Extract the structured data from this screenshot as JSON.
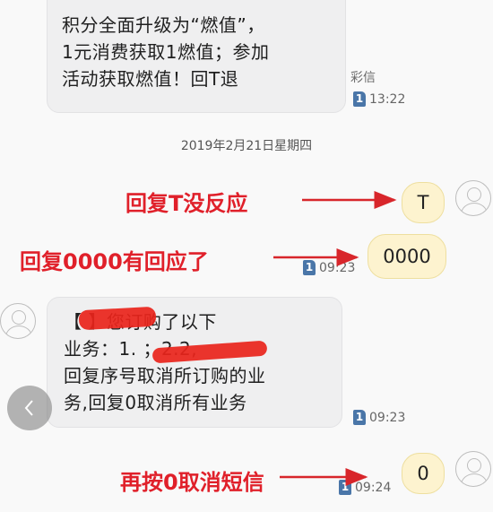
{
  "messages": {
    "incoming_1": {
      "lines": [
        "积分全面升级为“燃值”，",
        "1元消费获取1燃值；参加",
        "活动获取燃值！回T退"
      ],
      "type_label": "彩信",
      "sim": "1",
      "time": "13:22"
    },
    "date_separator": "2019年2月21日星期四",
    "sent_1": {
      "text": "T"
    },
    "sent_2": {
      "text": "0000",
      "sim": "1",
      "time": "09:23"
    },
    "incoming_2": {
      "lines": [
        "【      】您订购了以下",
        "业务：1.              ；2.2,",
        "回复序号取消所订购的业",
        "务,回复0取消所有业务"
      ],
      "sim": "1",
      "time": "09:23"
    },
    "sent_3": {
      "text": "0",
      "sim": "1",
      "time": "09:24"
    }
  },
  "annotations": {
    "a1": "回复T没反应",
    "a2": "回复0000有回应了",
    "a3": "再按0取消短信"
  },
  "colors": {
    "annotation_red": "#e0202a",
    "incoming_bubble": "#efeff0",
    "outgoing_bubble": "#fdf3cf",
    "sim_badge": "#4a76a8"
  },
  "icons": {
    "avatar": "person-outline-icon",
    "back": "chevron-left-icon",
    "sim": "sim-card-1-icon"
  }
}
